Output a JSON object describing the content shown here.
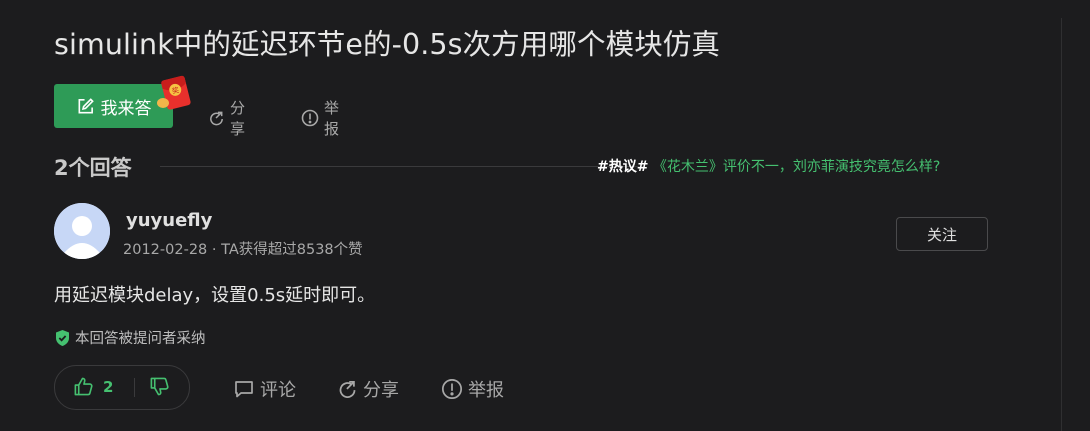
{
  "question": {
    "title": "simulink中的延迟环节e的-0.5s次方用哪个模块仿真"
  },
  "actions": {
    "answer_label": "我来答",
    "share_label": "分享",
    "report_label": "举报"
  },
  "answers_header": {
    "count_label": "2个回答",
    "hot_tag": "#热议#",
    "hot_text": " 《花木兰》评价不一，刘亦菲演技究竟怎么样?"
  },
  "answer": {
    "username": "yuyuefly",
    "meta": "2012-02-28 · TA获得超过8538个赞",
    "follow_label": "关注",
    "content": "用延迟模块delay，设置0.5s延时即可。",
    "accepted_label": "本回答被提问者采纳",
    "upvotes": "2",
    "comment_label": "评论",
    "share_label": "分享",
    "report_label": "举报"
  },
  "colors": {
    "background": "#1c1c1e",
    "accent_green": "#2e9b57",
    "link_green": "#45c070",
    "muted_text": "#a8a8a8"
  },
  "icons": {
    "edit": "edit-icon",
    "red_packet": "red-packet-icon",
    "share": "share-icon",
    "report": "report-icon",
    "shield": "shield-check-icon",
    "thumb_up": "thumb-up-icon",
    "thumb_down": "thumb-down-icon",
    "comment": "comment-icon"
  }
}
